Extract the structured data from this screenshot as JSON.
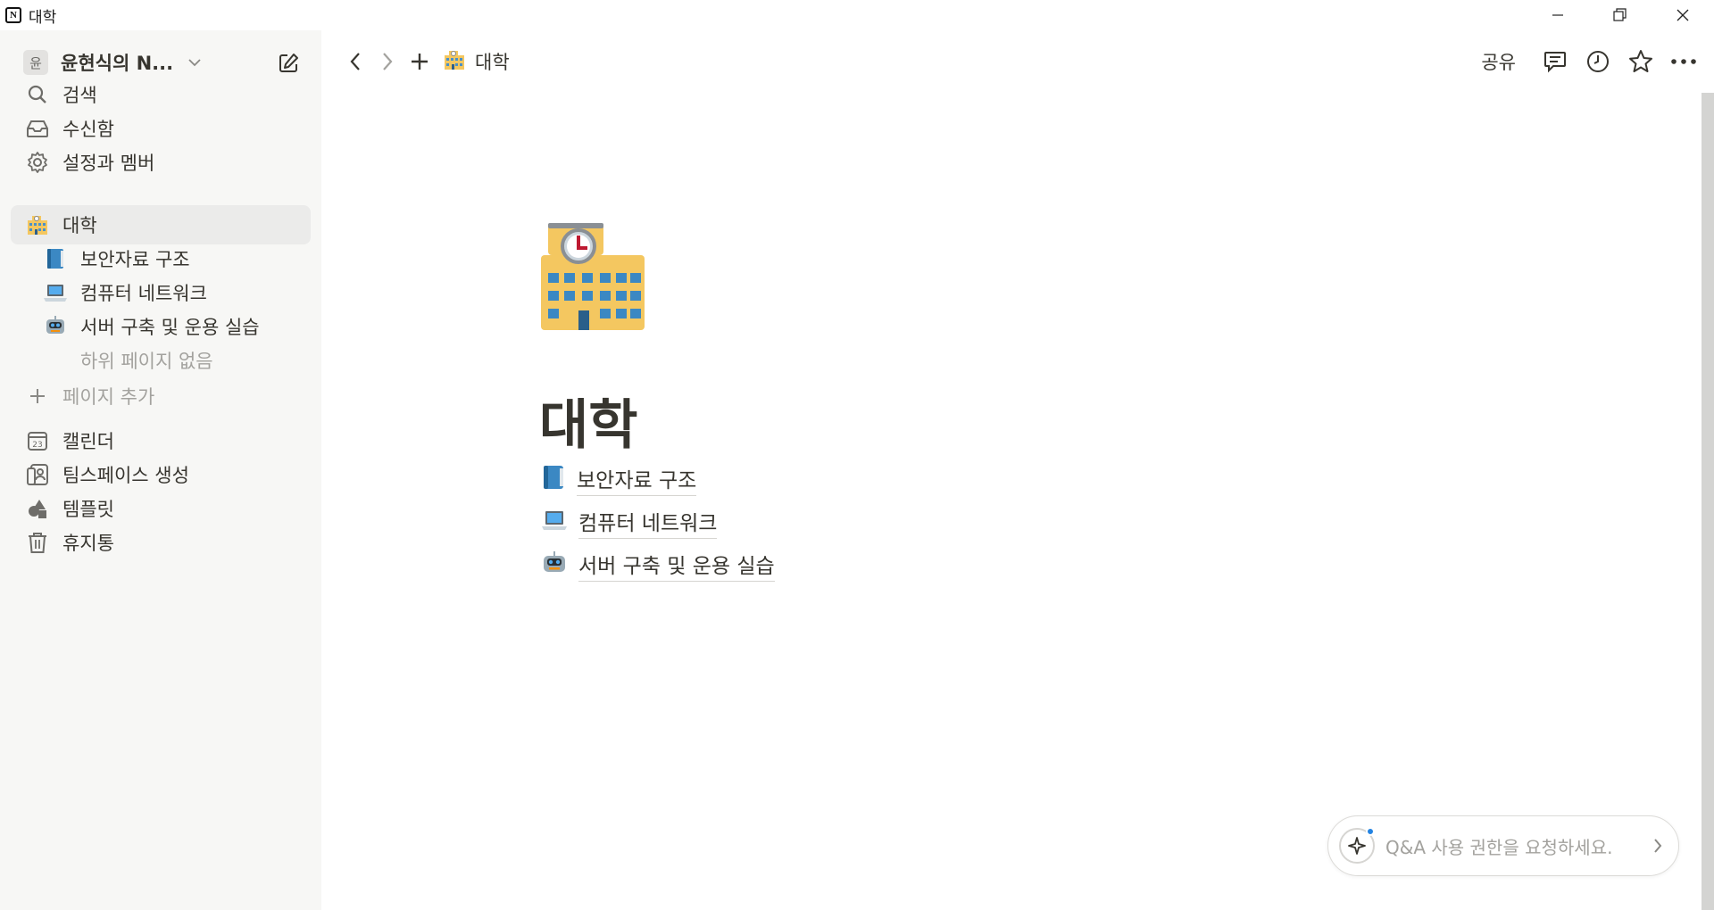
{
  "window": {
    "title": "대학"
  },
  "sidebar": {
    "workspace": {
      "avatar": "윤",
      "name": "윤현식의 N..."
    },
    "top_items": [
      {
        "label": "검색",
        "icon": "search-icon"
      },
      {
        "label": "수신함",
        "icon": "inbox-icon"
      },
      {
        "label": "설정과 멤버",
        "icon": "gear-icon"
      }
    ],
    "pages": [
      {
        "label": "대학",
        "icon": "school-building-icon",
        "active": true
      },
      {
        "label": "보안자료 구조",
        "icon": "blue-book-icon"
      },
      {
        "label": "컴퓨터 네트워크",
        "icon": "laptop-icon"
      },
      {
        "label": "서버 구축 및 운용 실습",
        "icon": "robot-icon"
      },
      {
        "label": "하위 페이지 없음"
      },
      {
        "label": "페이지 추가",
        "icon": "plus-icon"
      }
    ],
    "bottom_items": [
      {
        "label": "캘린더",
        "icon": "calendar-icon"
      },
      {
        "label": "팀스페이스 생성",
        "icon": "teamspace-icon"
      },
      {
        "label": "템플릿",
        "icon": "shapes-icon"
      },
      {
        "label": "휴지통",
        "icon": "trash-icon"
      }
    ]
  },
  "topbar": {
    "breadcrumb": "대학",
    "share_label": "공유"
  },
  "page": {
    "title": "대학",
    "links": [
      {
        "label": "보안자료 구조",
        "icon": "blue-book-icon"
      },
      {
        "label": "컴퓨터 네트워크",
        "icon": "laptop-icon"
      },
      {
        "label": "서버 구축 및 운용 실습",
        "icon": "robot-icon"
      }
    ]
  },
  "qa": {
    "placeholder": "Q&A 사용 권한을 요청하세요."
  },
  "colors": {
    "sidebar_bg": "#f7f7f5",
    "text": "#37352f",
    "muted": "#a3a29e",
    "accent": "#2383e2"
  }
}
